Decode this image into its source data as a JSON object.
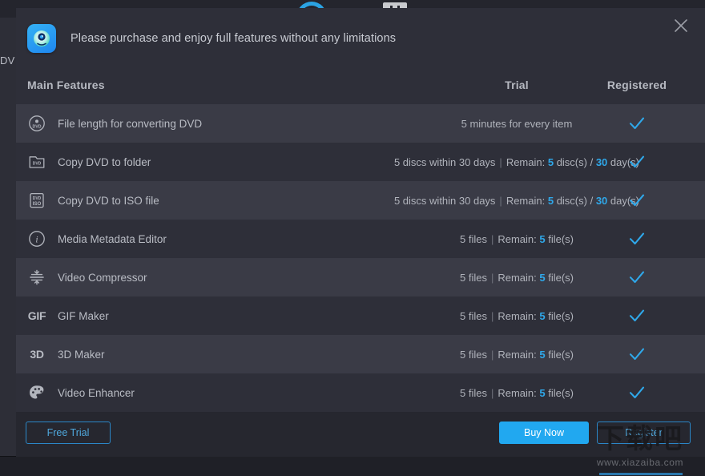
{
  "background": {
    "left_tab_label": "DV",
    "topbar_icons": [
      "arc-icon",
      "device-icon"
    ]
  },
  "dialog": {
    "close_icon": "close-icon",
    "app_icon": "disc-app-icon",
    "header_text": "Please purchase and enjoy full features without any limitations",
    "columns": {
      "features": "Main Features",
      "trial": "Trial",
      "registered": "Registered"
    },
    "rows": [
      {
        "icon": "dvd-disc-icon",
        "icon_glyph": "",
        "name": "File length for converting DVD",
        "trial_prefix": "5 minutes for every item",
        "trial_has_sep": false,
        "trial_remain_label": "",
        "trial_value1": "",
        "trial_mid": "",
        "trial_value2": "",
        "trial_suffix": "",
        "registered": "check-icon"
      },
      {
        "icon": "dvd-folder-icon",
        "icon_glyph": "",
        "name": "Copy DVD to folder",
        "trial_prefix": "5 discs within 30 days",
        "trial_has_sep": true,
        "trial_remain_label": "Remain: ",
        "trial_value1": "5",
        "trial_mid": " disc(s) / ",
        "trial_value2": "30",
        "trial_suffix": " day(s)",
        "registered": "check-icon"
      },
      {
        "icon": "dvd-iso-icon",
        "icon_glyph": "",
        "name": "Copy DVD to ISO file",
        "trial_prefix": "5 discs within 30 days",
        "trial_has_sep": true,
        "trial_remain_label": "Remain: ",
        "trial_value1": "5",
        "trial_mid": " disc(s) / ",
        "trial_value2": "30",
        "trial_suffix": " day(s)",
        "registered": "check-icon"
      },
      {
        "icon": "info-circle-icon",
        "icon_glyph": "",
        "name": "Media Metadata Editor",
        "trial_prefix": "5 files",
        "trial_has_sep": true,
        "trial_remain_label": "Remain: ",
        "trial_value1": "5",
        "trial_mid": " file(s)",
        "trial_value2": "",
        "trial_suffix": "",
        "registered": "check-icon"
      },
      {
        "icon": "compress-icon",
        "icon_glyph": "",
        "name": "Video Compressor",
        "trial_prefix": "5 files",
        "trial_has_sep": true,
        "trial_remain_label": "Remain: ",
        "trial_value1": "5",
        "trial_mid": " file(s)",
        "trial_value2": "",
        "trial_suffix": "",
        "registered": "check-icon"
      },
      {
        "icon": "gif-text-icon",
        "icon_glyph": "GIF",
        "name": "GIF Maker",
        "trial_prefix": "5 files",
        "trial_has_sep": true,
        "trial_remain_label": "Remain: ",
        "trial_value1": "5",
        "trial_mid": " file(s)",
        "trial_value2": "",
        "trial_suffix": "",
        "registered": "check-icon"
      },
      {
        "icon": "3d-text-icon",
        "icon_glyph": "3D",
        "name": "3D Maker",
        "trial_prefix": "5 files",
        "trial_has_sep": true,
        "trial_remain_label": "Remain: ",
        "trial_value1": "5",
        "trial_mid": " file(s)",
        "trial_value2": "",
        "trial_suffix": "",
        "registered": "check-icon"
      },
      {
        "icon": "palette-icon",
        "icon_glyph": "",
        "name": "Video Enhancer",
        "trial_prefix": "5 files",
        "trial_has_sep": true,
        "trial_remain_label": "Remain: ",
        "trial_value1": "5",
        "trial_mid": " file(s)",
        "trial_value2": "",
        "trial_suffix": "",
        "registered": "check-icon"
      }
    ],
    "buttons": {
      "free_trial": "Free Trial",
      "buy_now": "Buy Now",
      "register": "Register"
    }
  },
  "watermark": {
    "cn_text": "下载吧",
    "url_text": "www.xiazaiba.com"
  },
  "colors": {
    "accent_blue": "#21a8f0",
    "check_blue": "#2fa8ea",
    "dialog_bg": "#2e2f39",
    "row_alt_bg": "#3a3b46",
    "footer_bg": "#26272f",
    "text_primary": "#b9bcc4"
  }
}
